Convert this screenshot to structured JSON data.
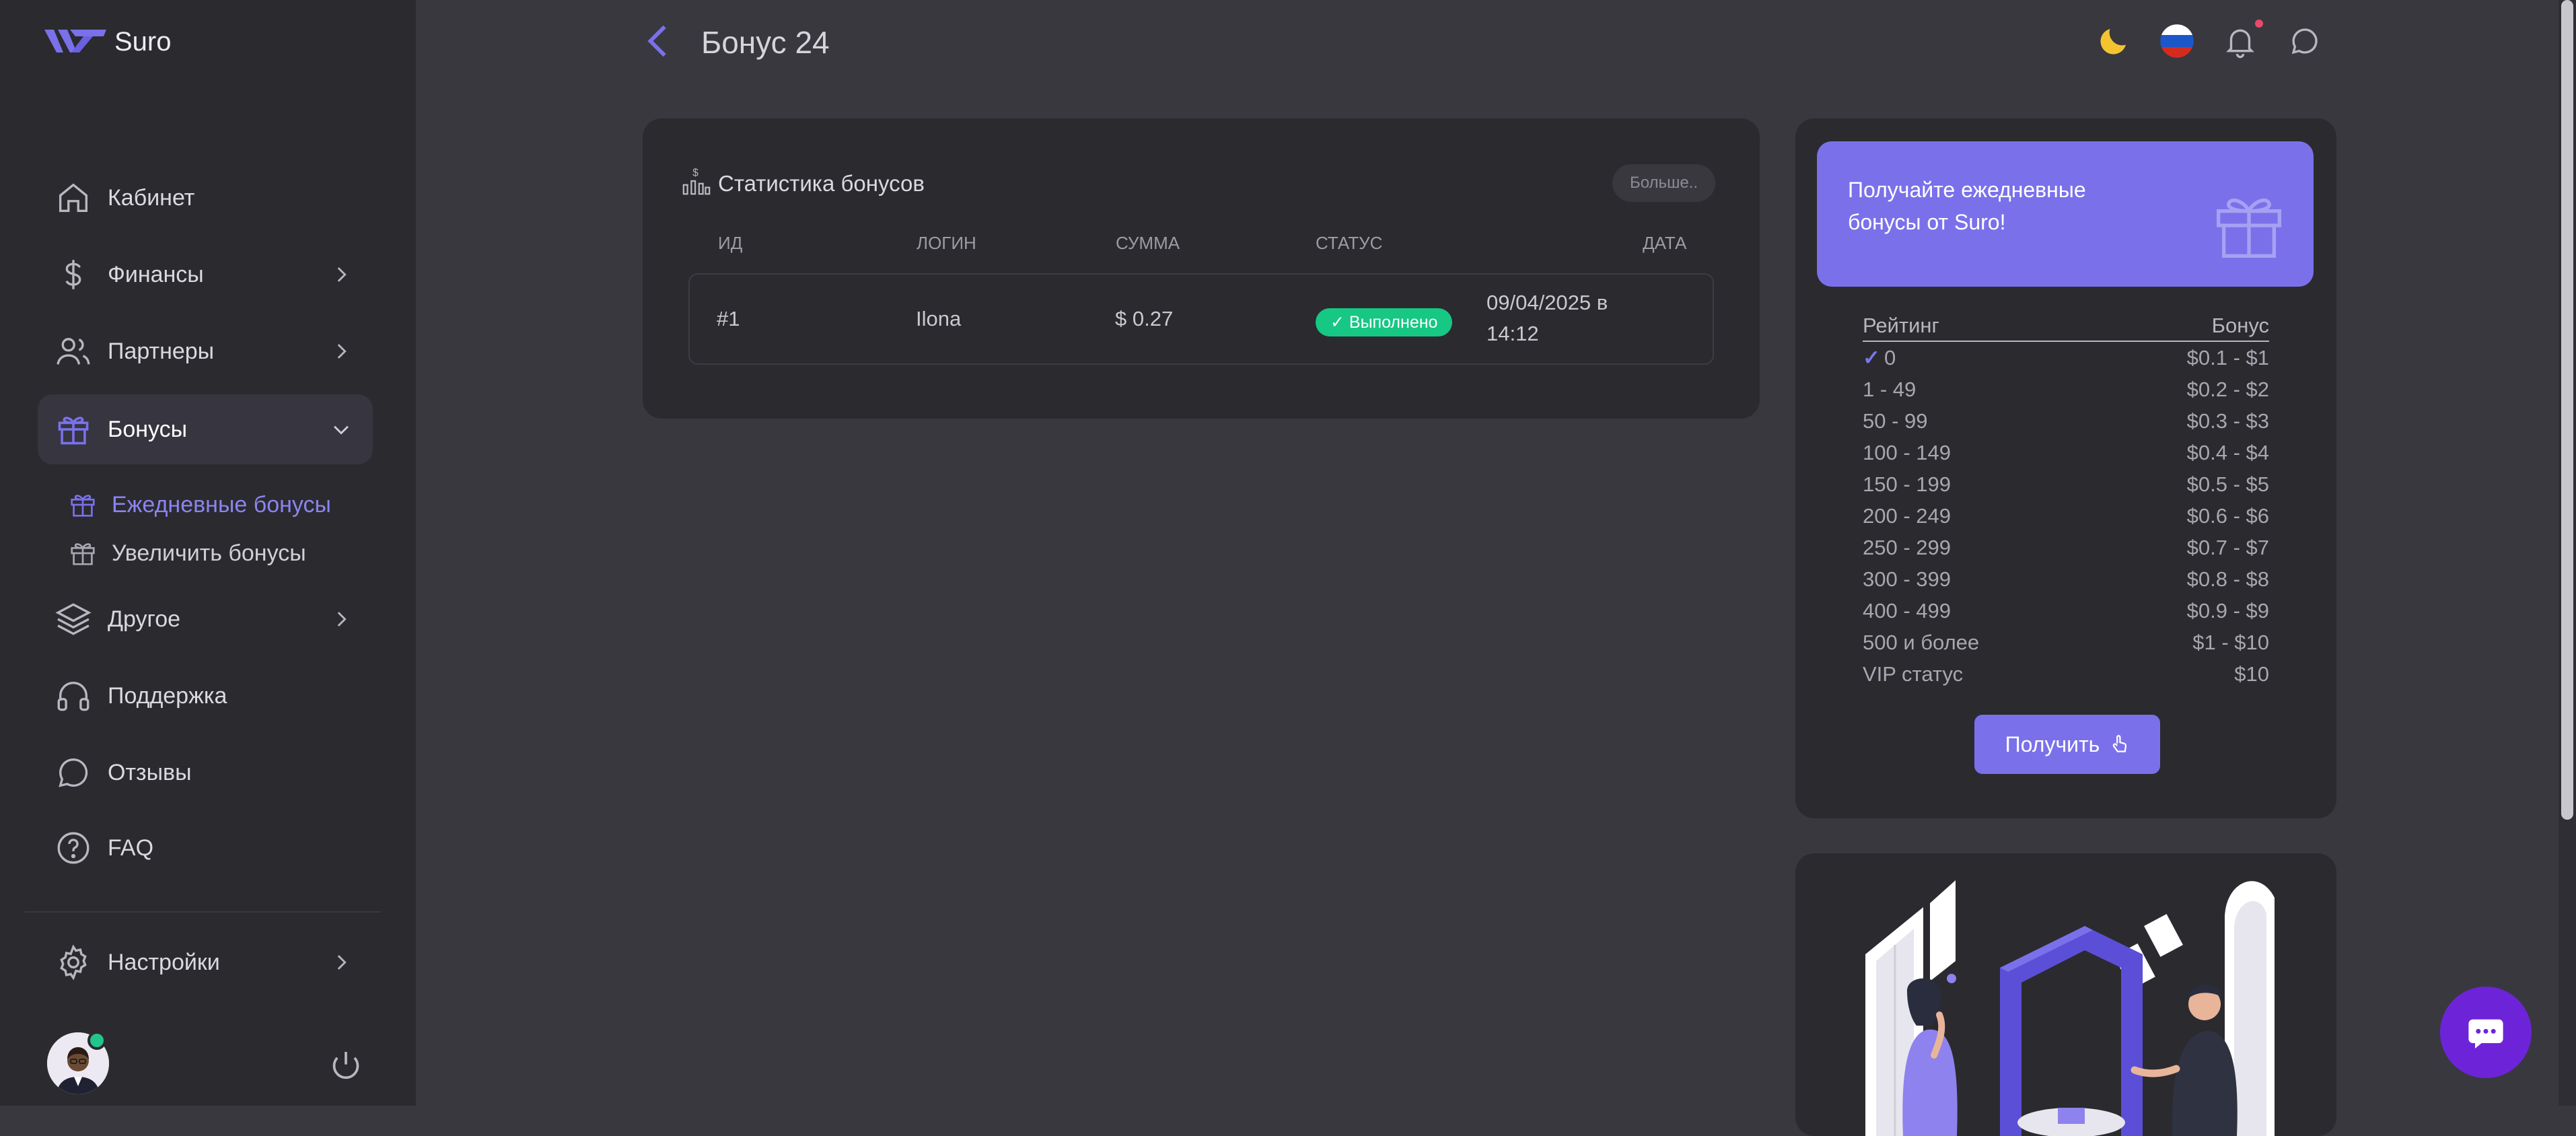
{
  "app": {
    "name": "Suro"
  },
  "sidebar": {
    "items": [
      {
        "label": "Кабинет",
        "icon": "home-icon"
      },
      {
        "label": "Финансы",
        "icon": "dollar-icon"
      },
      {
        "label": "Партнеры",
        "icon": "users-icon"
      },
      {
        "label": "Бонусы",
        "icon": "gift-icon"
      },
      {
        "label": "Другое",
        "icon": "layers-icon"
      },
      {
        "label": "Поддержка",
        "icon": "headphones-icon"
      },
      {
        "label": "Отзывы",
        "icon": "chat-bubble-icon"
      },
      {
        "label": "FAQ",
        "icon": "question-icon"
      },
      {
        "label": "Настройки",
        "icon": "gear-icon"
      }
    ],
    "subitems": [
      {
        "label": "Ежедневные бонусы",
        "icon": "gift-icon"
      },
      {
        "label": "Увеличить бонусы",
        "icon": "gift-icon"
      }
    ]
  },
  "header": {
    "title": "Бонус 24"
  },
  "stats": {
    "title": "Статистика бонусов",
    "more_label": "Больше..",
    "columns": [
      "ИД",
      "ЛОГИН",
      "СУММА",
      "СТАТУС",
      "ДАТА"
    ],
    "rows": [
      {
        "id": "#1",
        "login": "Ilona",
        "amount": "$ 0.27",
        "status": "✓ Выполнено",
        "date_line1": "09/04/2025 в",
        "date_line2": "14:12"
      }
    ]
  },
  "bonus_card": {
    "banner_text": "Получайте ежедневные бонусы от Suro!",
    "col_rating": "Рейтинг",
    "col_bonus": "Бонус",
    "check_mark": "✓",
    "tiers": [
      {
        "rating": "0",
        "bonus": "$0.1 - $1",
        "current": true
      },
      {
        "rating": "1 - 49",
        "bonus": "$0.2 - $2"
      },
      {
        "rating": "50 - 99",
        "bonus": "$0.3 - $3"
      },
      {
        "rating": "100 - 149",
        "bonus": "$0.4 - $4"
      },
      {
        "rating": "150 - 199",
        "bonus": "$0.5 - $5"
      },
      {
        "rating": "200 - 249",
        "bonus": "$0.6 - $6"
      },
      {
        "rating": "250 - 299",
        "bonus": "$0.7 - $7"
      },
      {
        "rating": "300 - 399",
        "bonus": "$0.8 - $8"
      },
      {
        "rating": "400 - 499",
        "bonus": "$0.9 - $9"
      },
      {
        "rating": "500 и более",
        "bonus": "$1 - $10"
      },
      {
        "rating": "VIP статус",
        "bonus": "$10"
      }
    ],
    "button_label": "Получить"
  },
  "colors": {
    "accent": "#7a71ea",
    "success": "#17c784",
    "sidebar": "#2b2a2f",
    "background": "#39383f"
  }
}
